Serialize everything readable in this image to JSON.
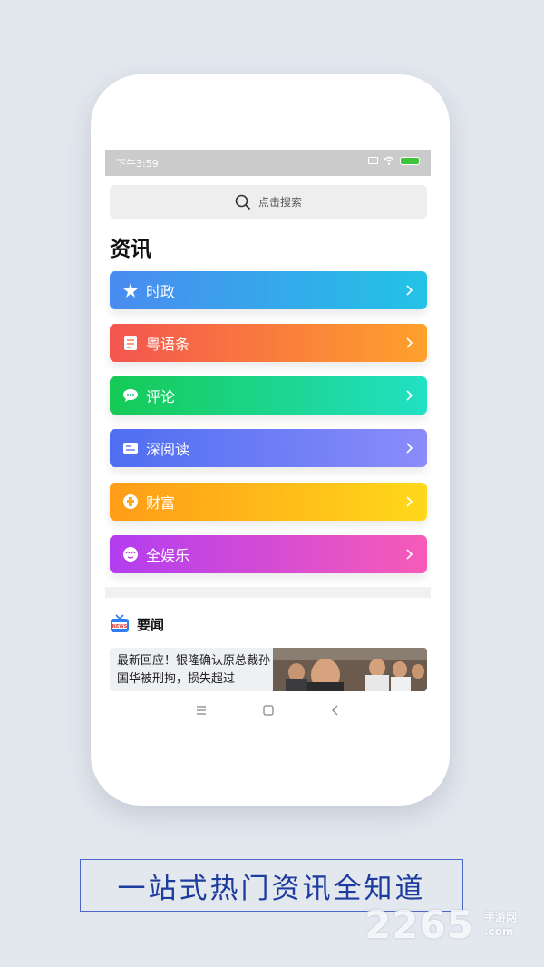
{
  "status_bar": {
    "time": "下午3:59"
  },
  "search": {
    "placeholder": "点击搜索"
  },
  "section": {
    "title": "资讯"
  },
  "categories": [
    {
      "label": "时政",
      "icon": "star-person-icon",
      "gradient": [
        "#4a8bf0",
        "#22c3e6"
      ]
    },
    {
      "label": "粤语条",
      "icon": "notebook-icon",
      "gradient": [
        "#f3554f",
        "#ffa12c"
      ]
    },
    {
      "label": "评论",
      "icon": "chat-bubble-icon",
      "gradient": [
        "#16ca55",
        "#22e0c4"
      ]
    },
    {
      "label": "深阅读",
      "icon": "id-card-icon",
      "gradient": [
        "#4e6ef1",
        "#8b8cfa"
      ]
    },
    {
      "label": "财富",
      "icon": "coin-icon",
      "gradient": [
        "#ff9c18",
        "#ffd81a"
      ]
    },
    {
      "label": "全娱乐",
      "icon": "mask-icon",
      "gradient": [
        "#b23df0",
        "#f75bb7"
      ]
    }
  ],
  "news": {
    "header": "要闻",
    "icon_badge": "NEWS",
    "headline": "最新回应！银隆确认原总裁孙国华被刑拘，损失超过"
  },
  "caption": "一站式热门资讯全知道",
  "watermark": {
    "number": "2265",
    "line1": "手游网",
    "line2": ".com"
  }
}
